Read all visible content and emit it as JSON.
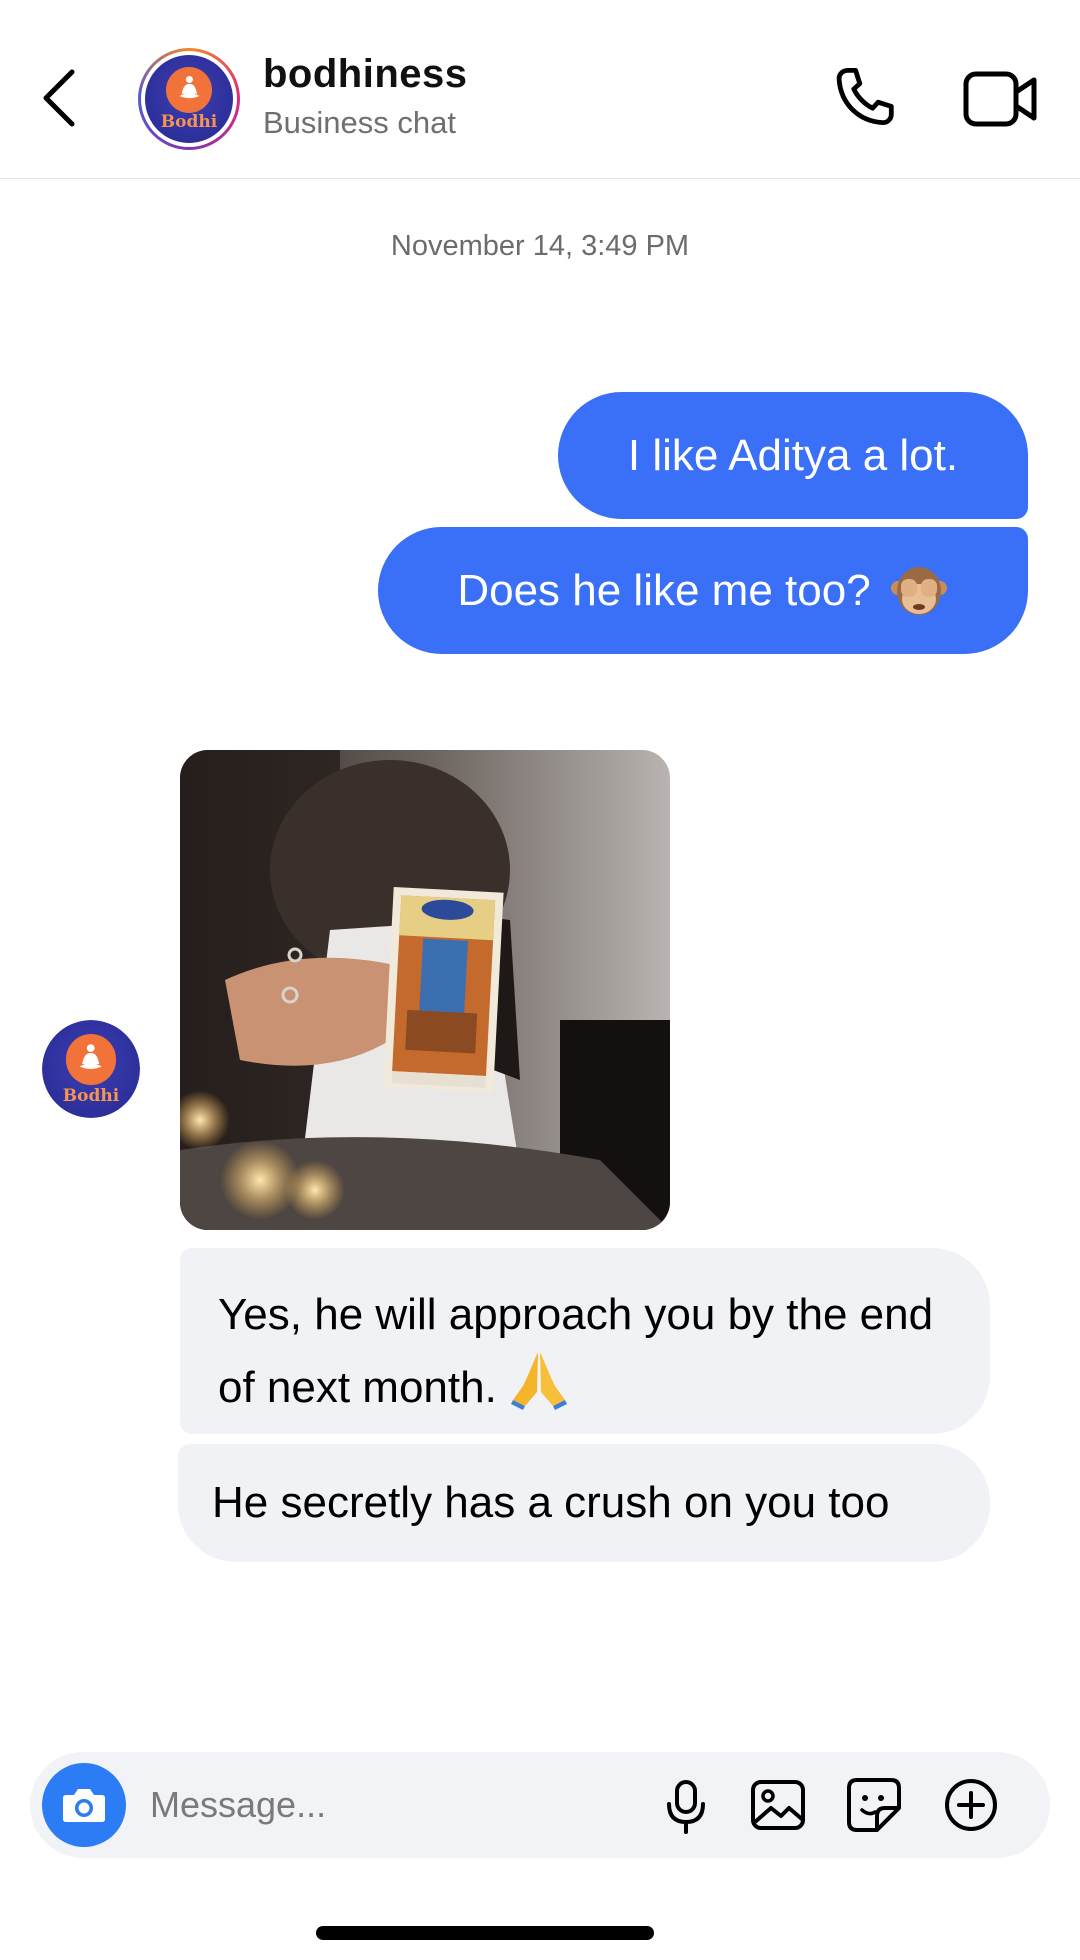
{
  "header": {
    "title": "bodhiness",
    "subtitle": "Business chat",
    "logo_text": "Bodhi"
  },
  "timestamp": "November 14, 3:49 PM",
  "messages": {
    "outgoing_1": "I like Aditya a lot.",
    "outgoing_2": "Does he like me too?",
    "outgoing_2_emoji": "see-no-evil-monkey",
    "incoming_1": "Yes, he will approach you by the end of next month.",
    "incoming_1_emoji": "folded-hands",
    "incoming_2": "He secretly has a crush on you too"
  },
  "composer": {
    "placeholder": "Message..."
  },
  "colors": {
    "outgoing_bubble": "#3a6ff7",
    "incoming_bubble": "#f1f2f6",
    "camera_button": "#2c7cf6",
    "logo_bg": "#2d2f9b",
    "logo_accent": "#f2733a"
  }
}
